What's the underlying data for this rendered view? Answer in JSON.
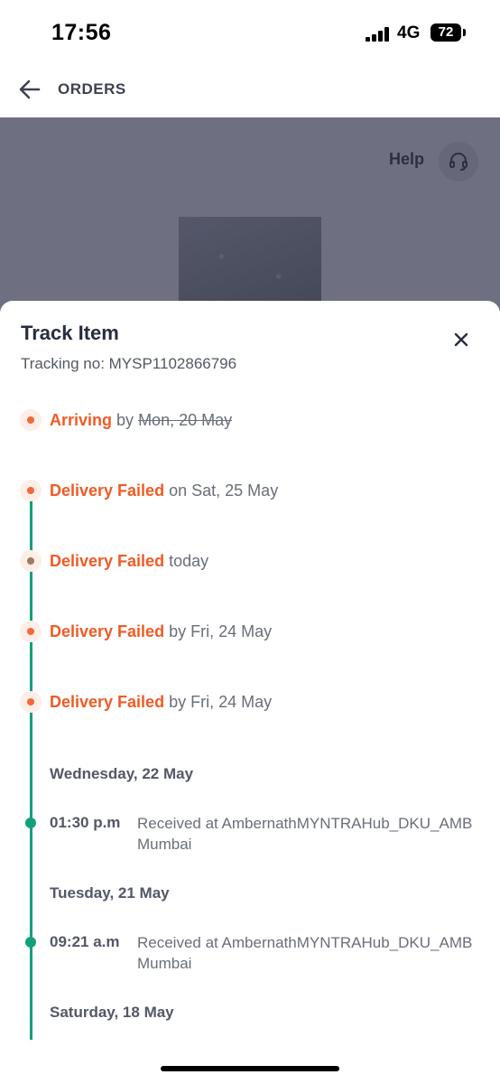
{
  "status_bar": {
    "time": "17:56",
    "network": "4G",
    "battery": "72"
  },
  "header": {
    "title": "ORDERS"
  },
  "background": {
    "help_label": "Help"
  },
  "sheet": {
    "title": "Track Item",
    "tracking": "Tracking no: MYSP1102866796",
    "statuses": [
      {
        "status": "Arriving",
        "connector": "by",
        "date": "Mon, 20 May",
        "struck": true
      },
      {
        "status": "Delivery Failed",
        "connector": "on",
        "date": "Sat, 25 May",
        "struck": false
      },
      {
        "status": "Delivery Failed",
        "connector": "",
        "date": "today",
        "struck": false
      },
      {
        "status": "Delivery Failed",
        "connector": "by",
        "date": "Fri, 24 May",
        "struck": false
      },
      {
        "status": "Delivery Failed",
        "connector": "by",
        "date": "Fri, 24 May",
        "struck": false
      }
    ],
    "events": [
      {
        "day": "Wednesday, 22 May",
        "time": "01:30 p.m",
        "desc": "Received at AmbernathMYNTRAHub_DKU_AMB Mumbai"
      },
      {
        "day": "Tuesday, 21 May",
        "time": "09:21 a.m",
        "desc": "Received at AmbernathMYNTRAHub_DKU_AMB Mumbai"
      },
      {
        "day": "Saturday, 18 May"
      }
    ]
  },
  "colors": {
    "accent": "#f05b24",
    "timeline": "#14a07a"
  }
}
